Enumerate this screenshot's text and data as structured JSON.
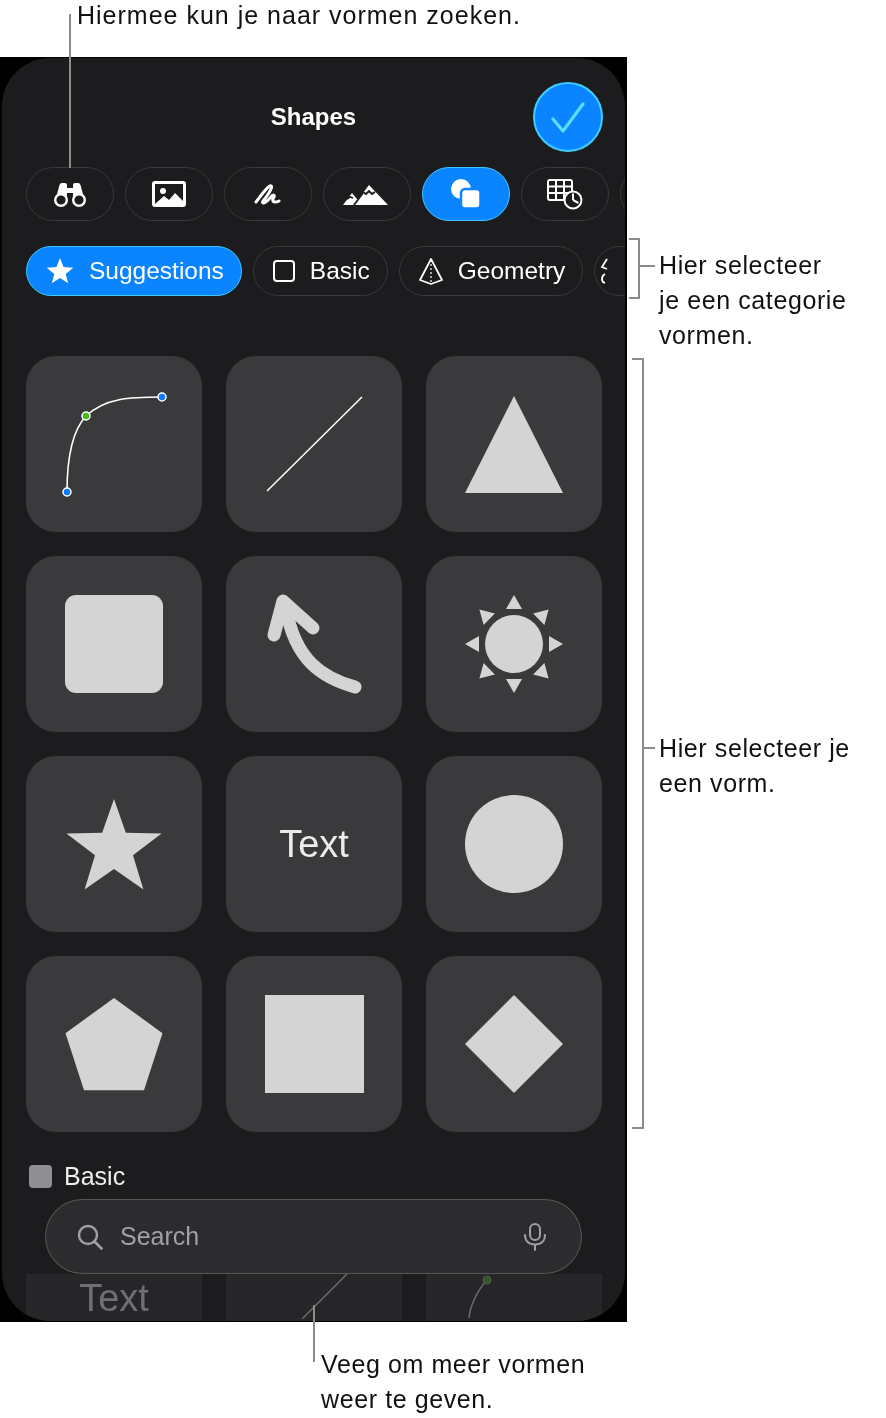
{
  "top_callout": {
    "lines": [
      "Hiermee kun je naar vormen zoeken."
    ]
  },
  "sheet": {
    "title": "Shapes",
    "toolbar": [
      {
        "kind": "binoculars",
        "selected": false
      },
      {
        "kind": "photo",
        "selected": false
      },
      {
        "kind": "scribble",
        "selected": false
      },
      {
        "kind": "mountains",
        "selected": false
      },
      {
        "kind": "shapes",
        "selected": true
      },
      {
        "kind": "table",
        "selected": false
      },
      {
        "kind": "clipped",
        "selected": false
      }
    ],
    "categories": [
      {
        "kind": "star",
        "label": "Suggestions",
        "selected": true
      },
      {
        "kind": "square",
        "label": "Basic",
        "selected": false
      },
      {
        "kind": "pyramid",
        "label": "Geometry",
        "selected": false
      },
      {
        "kind": "clipped",
        "selected": false
      }
    ],
    "shapes": [
      {
        "kind": "curve"
      },
      {
        "kind": "line"
      },
      {
        "kind": "triangle"
      },
      {
        "kind": "rounded_square"
      },
      {
        "kind": "arrow"
      },
      {
        "kind": "sun"
      },
      {
        "kind": "star"
      },
      {
        "kind": "text",
        "label": "Text"
      },
      {
        "kind": "circle"
      },
      {
        "kind": "pentagon"
      },
      {
        "kind": "square"
      },
      {
        "kind": "diamond"
      }
    ],
    "section": {
      "title": "Basic",
      "shapes": [
        {
          "kind": "text",
          "label": "Text"
        },
        {
          "kind": "line"
        },
        {
          "kind": "curve"
        }
      ]
    },
    "search": {
      "placeholder": "Search"
    }
  },
  "category_callout": {
    "lines": [
      "Hier selecteer",
      "je een categorie",
      "vormen."
    ]
  },
  "shape_callout": {
    "lines": [
      "Hier selecteer je",
      "een vorm."
    ]
  },
  "bottom_callout": {
    "lines": [
      "Veeg om meer vormen",
      "weer te geven."
    ]
  }
}
